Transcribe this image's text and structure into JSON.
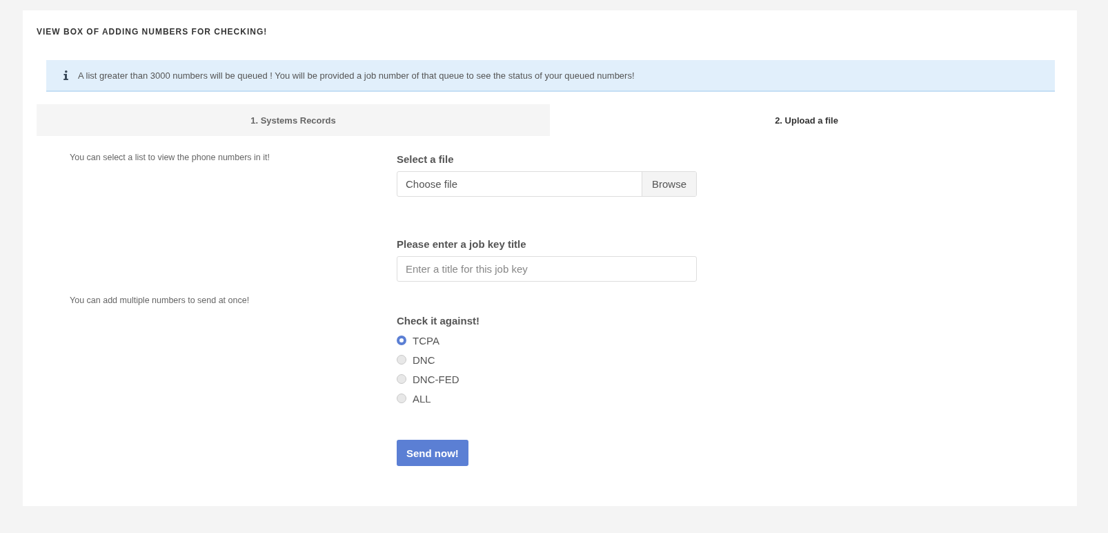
{
  "panel": {
    "title": "VIEW BOX OF ADDING NUMBERS FOR CHECKING!"
  },
  "alert": {
    "text": "A list greater than 3000 numbers will be queued ! You will be provided a job number of that queue to see the status of your queued numbers!"
  },
  "tabs": [
    {
      "label": "1. Systems Records",
      "selected": false
    },
    {
      "label": "2. Upload a file",
      "selected": true
    }
  ],
  "notes": [
    "You can select a list to view the phone numbers in it!",
    "You can add multiple numbers to send at once!"
  ],
  "file_field": {
    "label": "Select a file",
    "placeholder": "Choose file",
    "button": "Browse"
  },
  "title_field": {
    "label": "Please enter a job key title",
    "placeholder": "Enter a title for this job key"
  },
  "check_against": {
    "label": "Check it against!",
    "options": [
      {
        "label": "TCPA",
        "selected": true
      },
      {
        "label": "DNC",
        "selected": false
      },
      {
        "label": "DNC-FED",
        "selected": false
      },
      {
        "label": "ALL",
        "selected": false
      }
    ]
  },
  "submit": "Send now!"
}
